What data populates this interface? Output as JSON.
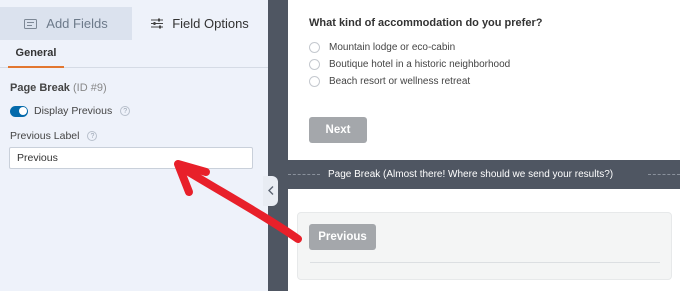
{
  "sidebar": {
    "tabs": [
      {
        "label": "Add Fields",
        "icon": "add-fields-icon"
      },
      {
        "label": "Field Options",
        "icon": "sliders-icon"
      }
    ],
    "subtabs": [
      {
        "label": "General"
      }
    ],
    "field": {
      "name": "Page Break",
      "id_text": "(ID #9)"
    },
    "display_previous": {
      "label": "Display Previous",
      "enabled": true
    },
    "previous_label": {
      "label": "Previous Label",
      "value": "Previous"
    }
  },
  "preview": {
    "question": "What kind of accommodation do you prefer?",
    "options": [
      "Mountain lodge or eco-cabin",
      "Boutique hotel in a historic neighborhood",
      "Beach resort or wellness retreat"
    ],
    "next_label": "Next",
    "page_break_text": "Page Break (Almost there! Where should we send your results?)",
    "previous_button_label": "Previous"
  },
  "colors": {
    "sidebar_bg": "#eef2fa",
    "accent_orange": "#e27730",
    "toggle_blue": "#036aab",
    "divider_dark": "#4f5662",
    "button_gray": "#a4a7ab",
    "annotation_red": "#e8202a"
  }
}
